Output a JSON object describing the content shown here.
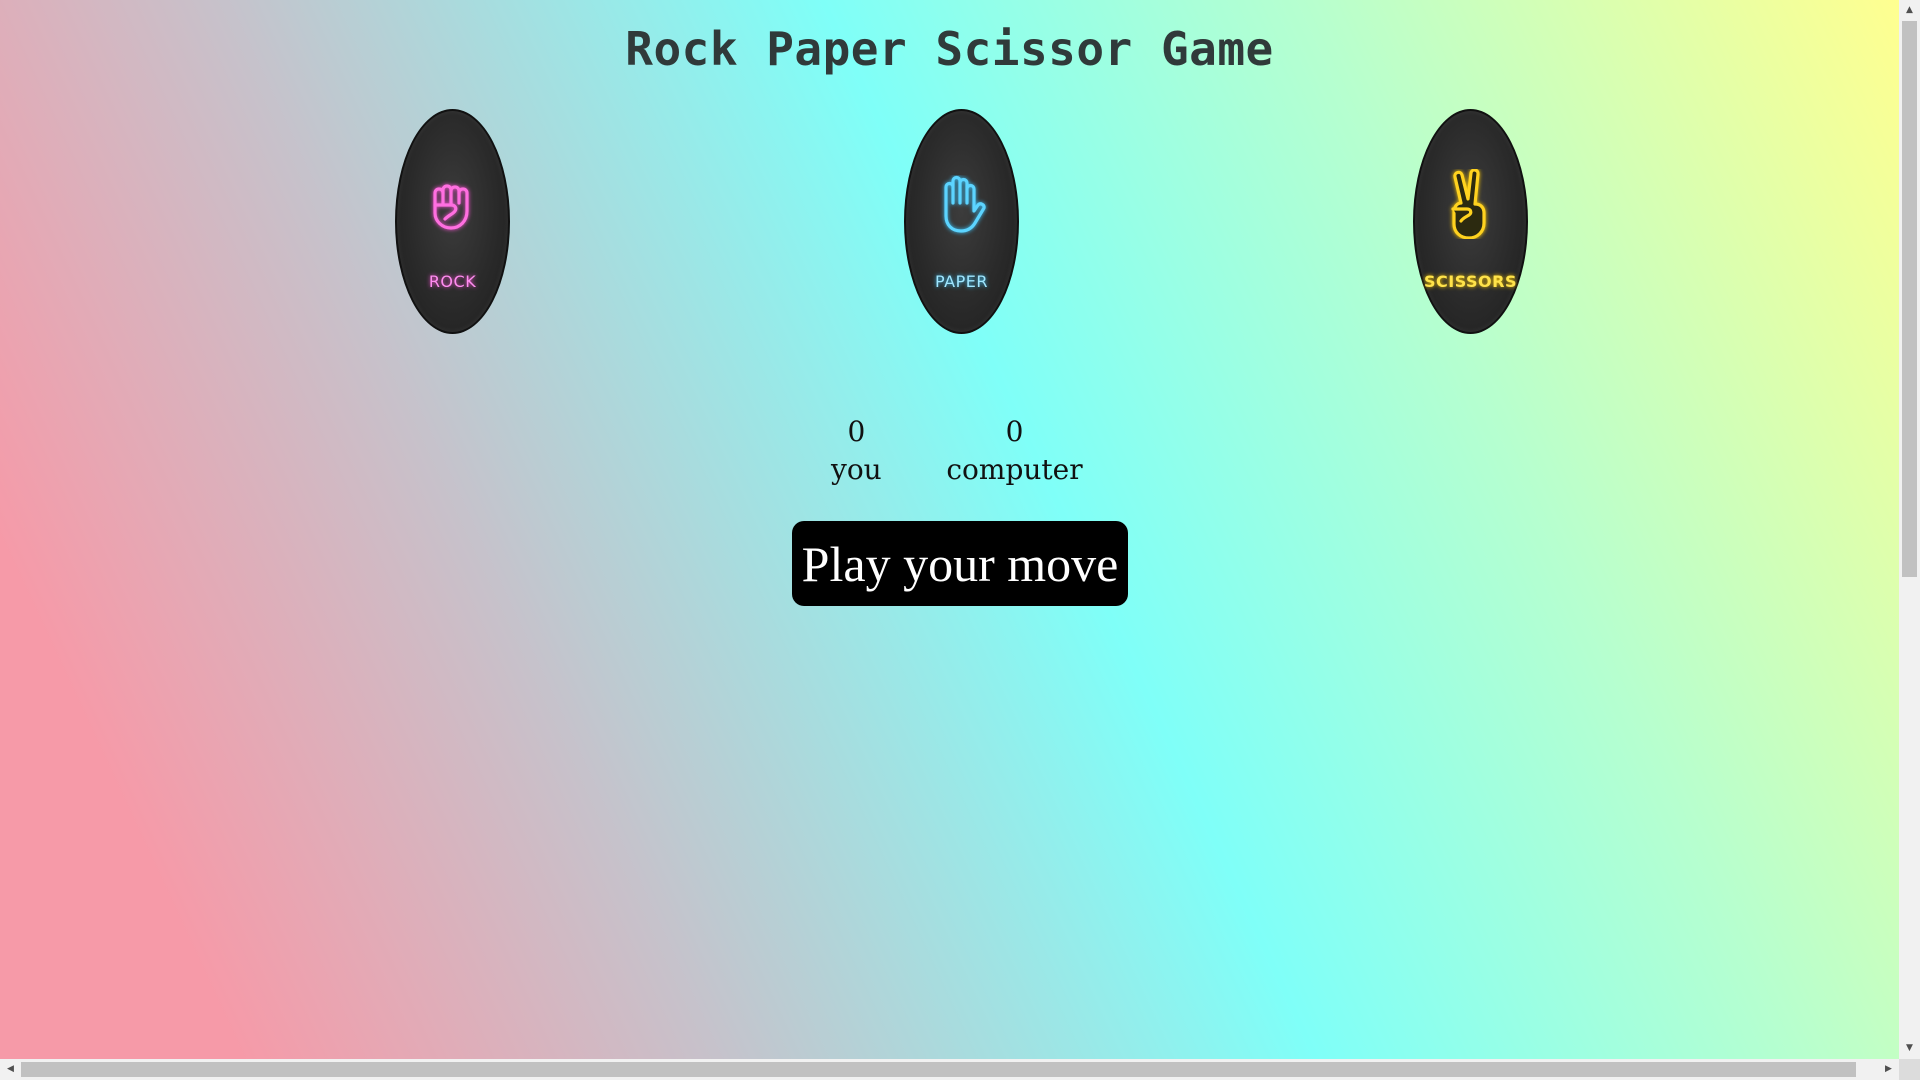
{
  "page": {
    "title": "Rock Paper Scissor Game"
  },
  "choices": [
    {
      "id": "rock",
      "label": "ROCK",
      "icon": "fist-icon",
      "color": "#ff6fe0"
    },
    {
      "id": "paper",
      "label": "PAPER",
      "icon": "open-hand-icon",
      "color": "#5cd4ff"
    },
    {
      "id": "scissors",
      "label": "SCISSORS",
      "icon": "peace-hand-icon",
      "color": "#ffd21f"
    }
  ],
  "scoreboard": {
    "user_score": "0",
    "user_label": "you",
    "computer_score": "0",
    "computer_label": "computer"
  },
  "message": {
    "text": "Play your move",
    "background": "#000000"
  },
  "scrollbars": {
    "up_arrow": "▲",
    "down_arrow": "▼",
    "left_arrow": "◀",
    "right_arrow": "▶"
  }
}
